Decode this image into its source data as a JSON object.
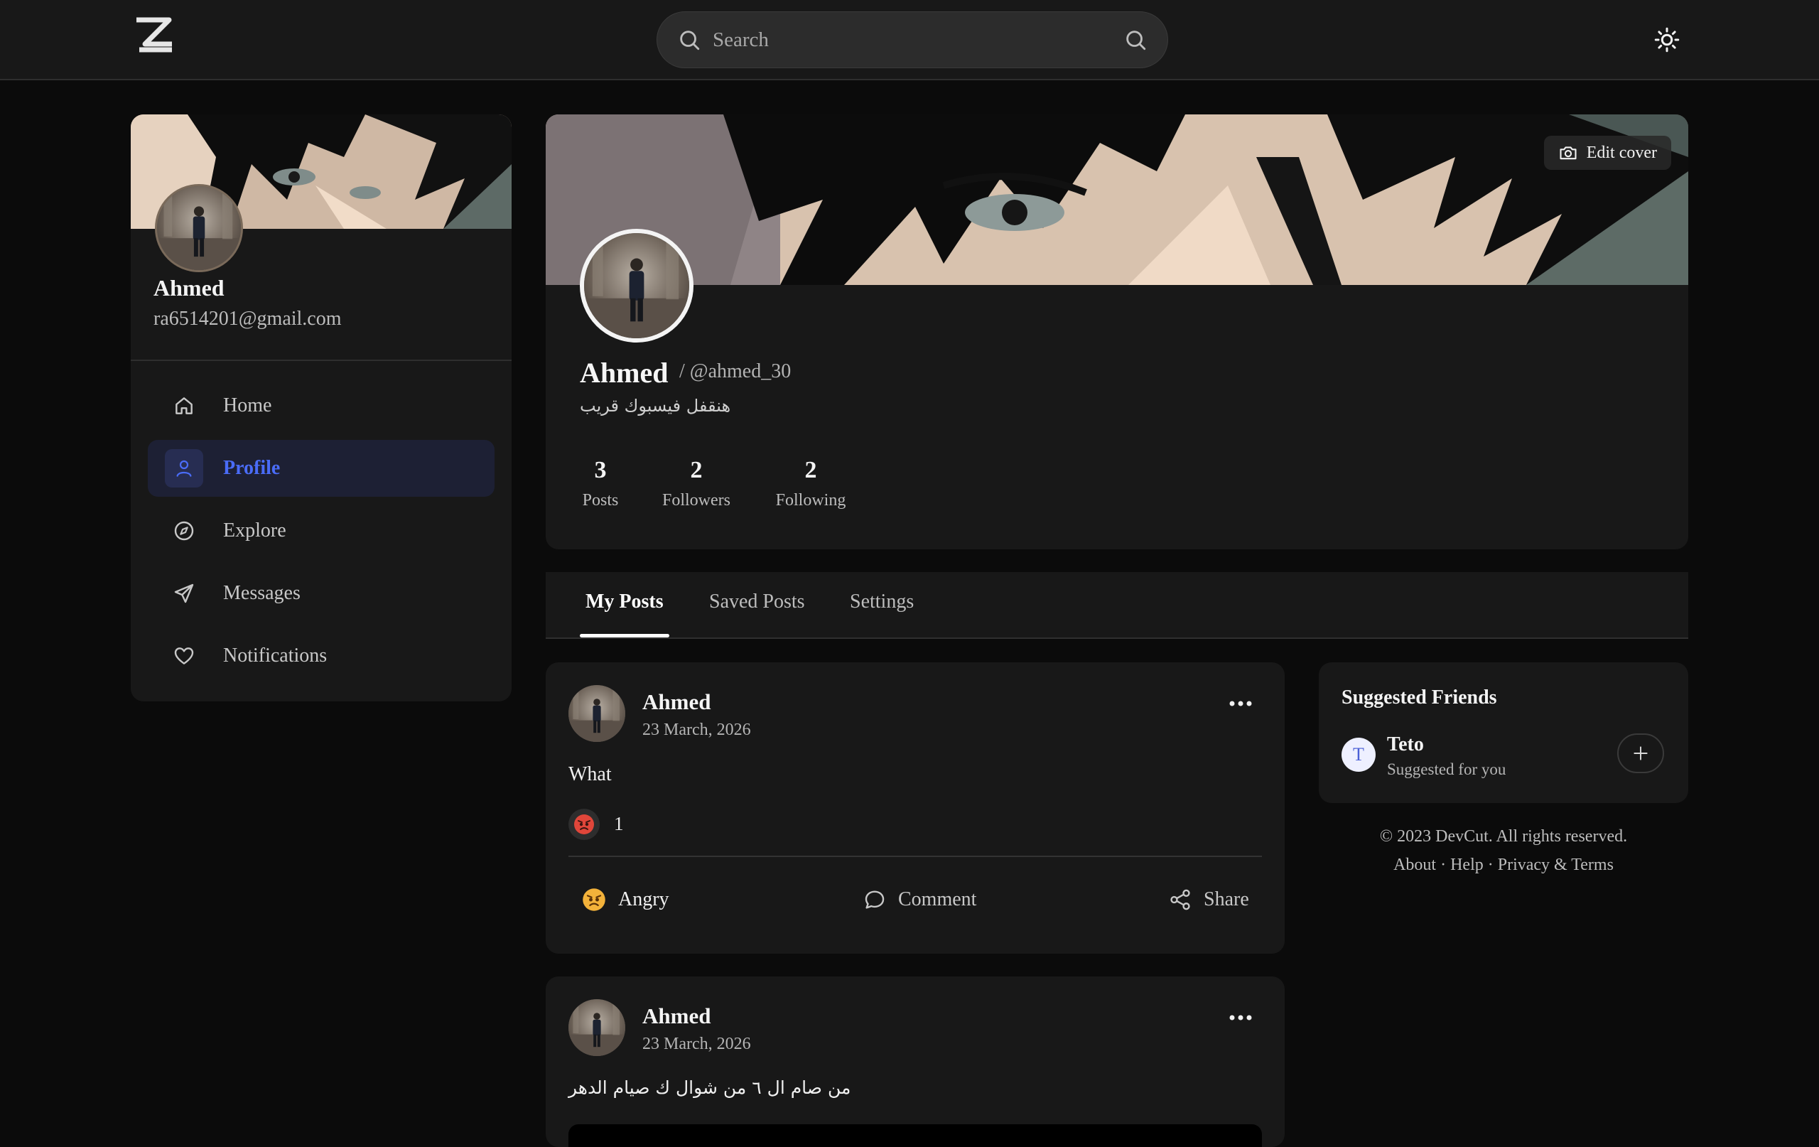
{
  "header": {
    "search_placeholder": "Search"
  },
  "sidebar": {
    "name": "Ahmed",
    "email": "ra6514201@gmail.com",
    "items": [
      {
        "label": "Home"
      },
      {
        "label": "Profile",
        "active": true
      },
      {
        "label": "Explore"
      },
      {
        "label": "Messages"
      },
      {
        "label": "Notifications"
      }
    ]
  },
  "profile": {
    "edit_cover_label": "Edit cover",
    "name": "Ahmed",
    "handle": "/ @ahmed_30",
    "bio": "هنقفل فيسبوك قريب",
    "stats": [
      {
        "value": "3",
        "label": "Posts"
      },
      {
        "value": "2",
        "label": "Followers"
      },
      {
        "value": "2",
        "label": "Following"
      }
    ]
  },
  "tabs": [
    {
      "label": "My Posts",
      "active": true
    },
    {
      "label": "Saved Posts"
    },
    {
      "label": "Settings"
    }
  ],
  "posts": [
    {
      "author": "Ahmed",
      "date": "23 March, 2026",
      "text": "What",
      "reaction_count": "1",
      "actions": {
        "react": "Angry",
        "comment": "Comment",
        "share": "Share"
      }
    },
    {
      "author": "Ahmed",
      "date": "23 March, 2026",
      "text": "من صام ال ٦ من شوال ك صيام الدهر"
    }
  ],
  "suggested": {
    "title": "Suggested Friends",
    "friends": [
      {
        "initial": "T",
        "name": "Teto",
        "subtitle": "Suggested for you"
      }
    ]
  },
  "footer": {
    "copyright": "© 2023 DevCut. All rights reserved.",
    "links": [
      "About",
      "Help",
      "Privacy & Terms"
    ],
    "separator": " · "
  },
  "colors": {
    "background": "#0b0b0b",
    "surface": "#181818",
    "accent": "#4a6cf7",
    "active_nav_bg": "#1d2034"
  },
  "icons": [
    "logo-icon",
    "search-icon",
    "sun-icon",
    "home-icon",
    "user-icon",
    "compass-icon",
    "send-icon",
    "heart-icon",
    "camera-icon",
    "more-icon",
    "angry-emoji-icon",
    "comment-icon",
    "share-icon",
    "plus-icon"
  ]
}
